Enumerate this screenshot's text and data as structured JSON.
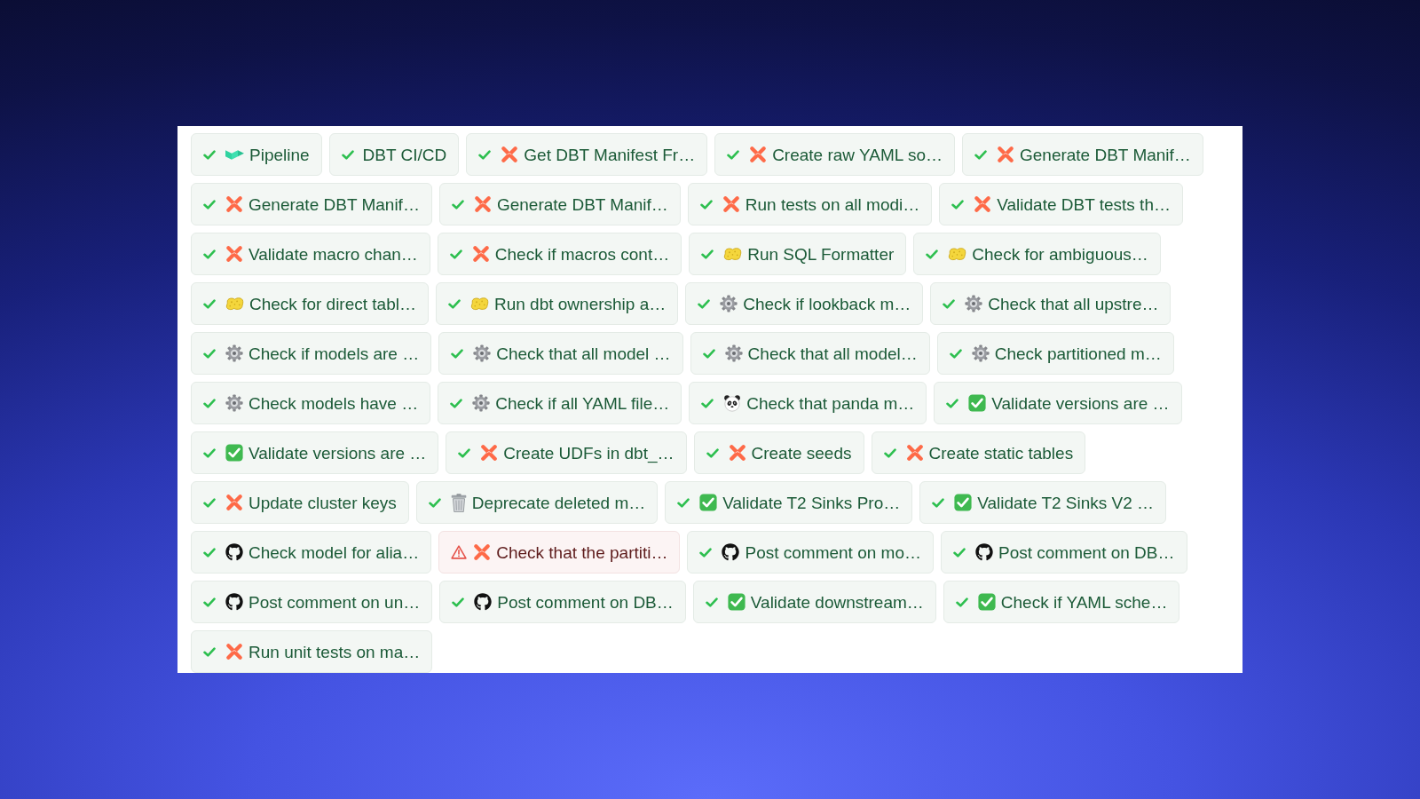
{
  "steps": [
    {
      "label": "Pipeline",
      "passed": true,
      "kind": "pipeline"
    },
    {
      "label": "DBT CI/CD",
      "passed": true,
      "kind": "plain"
    },
    {
      "label": "Get DBT Manifest Fr…",
      "passed": true,
      "kind": "dbt"
    },
    {
      "label": "Create raw YAML so…",
      "passed": true,
      "kind": "dbt"
    },
    {
      "label": "Generate DBT Manif…",
      "passed": true,
      "kind": "dbt"
    },
    {
      "label": "Generate DBT Manif…",
      "passed": true,
      "kind": "dbt"
    },
    {
      "label": "Generate DBT Manif…",
      "passed": true,
      "kind": "dbt"
    },
    {
      "label": "Run tests on all modi…",
      "passed": true,
      "kind": "dbt"
    },
    {
      "label": "Validate DBT tests th…",
      "passed": true,
      "kind": "dbt"
    },
    {
      "label": "Validate macro chan…",
      "passed": true,
      "kind": "dbt"
    },
    {
      "label": "Check if macros cont…",
      "passed": true,
      "kind": "dbt"
    },
    {
      "label": "Run SQL Formatter",
      "passed": true,
      "kind": "sponge"
    },
    {
      "label": "Check for ambiguous…",
      "passed": true,
      "kind": "sponge"
    },
    {
      "label": "Check for direct tabl…",
      "passed": true,
      "kind": "sponge"
    },
    {
      "label": "Run dbt ownership a…",
      "passed": true,
      "kind": "sponge"
    },
    {
      "label": "Check if lookback m…",
      "passed": true,
      "kind": "gear"
    },
    {
      "label": "Check that all upstre…",
      "passed": true,
      "kind": "gear"
    },
    {
      "label": "Check if models are …",
      "passed": true,
      "kind": "gear"
    },
    {
      "label": "Check that all model …",
      "passed": true,
      "kind": "gear"
    },
    {
      "label": "Check that all model…",
      "passed": true,
      "kind": "gear"
    },
    {
      "label": "Check partitioned m…",
      "passed": true,
      "kind": "gear"
    },
    {
      "label": "Check models have …",
      "passed": true,
      "kind": "gear"
    },
    {
      "label": "Check if all YAML file…",
      "passed": true,
      "kind": "gear"
    },
    {
      "label": "Check that panda m…",
      "passed": true,
      "kind": "panda"
    },
    {
      "label": "Validate versions are …",
      "passed": true,
      "kind": "checkmark"
    },
    {
      "label": "Validate versions are …",
      "passed": true,
      "kind": "checkmark"
    },
    {
      "label": "Create UDFs in dbt_…",
      "passed": true,
      "kind": "dbt"
    },
    {
      "label": "Create seeds",
      "passed": true,
      "kind": "dbt"
    },
    {
      "label": "Create static tables",
      "passed": true,
      "kind": "dbt"
    },
    {
      "label": "Update cluster keys",
      "passed": true,
      "kind": "dbt"
    },
    {
      "label": "Deprecate deleted m…",
      "passed": true,
      "kind": "trash"
    },
    {
      "label": "Validate T2 Sinks Pro…",
      "passed": true,
      "kind": "checkmark"
    },
    {
      "label": "Validate T2 Sinks V2 …",
      "passed": true,
      "kind": "checkmark"
    },
    {
      "label": "Check model for alia…",
      "passed": true,
      "kind": "github"
    },
    {
      "label": "Check that the partiti…",
      "passed": false,
      "kind": "dbt"
    },
    {
      "label": "Post comment on mo…",
      "passed": true,
      "kind": "github"
    },
    {
      "label": "Post comment on DB…",
      "passed": true,
      "kind": "github"
    },
    {
      "label": "Post comment on un…",
      "passed": true,
      "kind": "github"
    },
    {
      "label": "Post comment on DB…",
      "passed": true,
      "kind": "github"
    },
    {
      "label": "Validate downstream…",
      "passed": true,
      "kind": "checkmark"
    },
    {
      "label": "Check if YAML sche…",
      "passed": true,
      "kind": "checkmark"
    },
    {
      "label": "Run unit tests on ma…",
      "passed": true,
      "kind": "dbt"
    }
  ]
}
